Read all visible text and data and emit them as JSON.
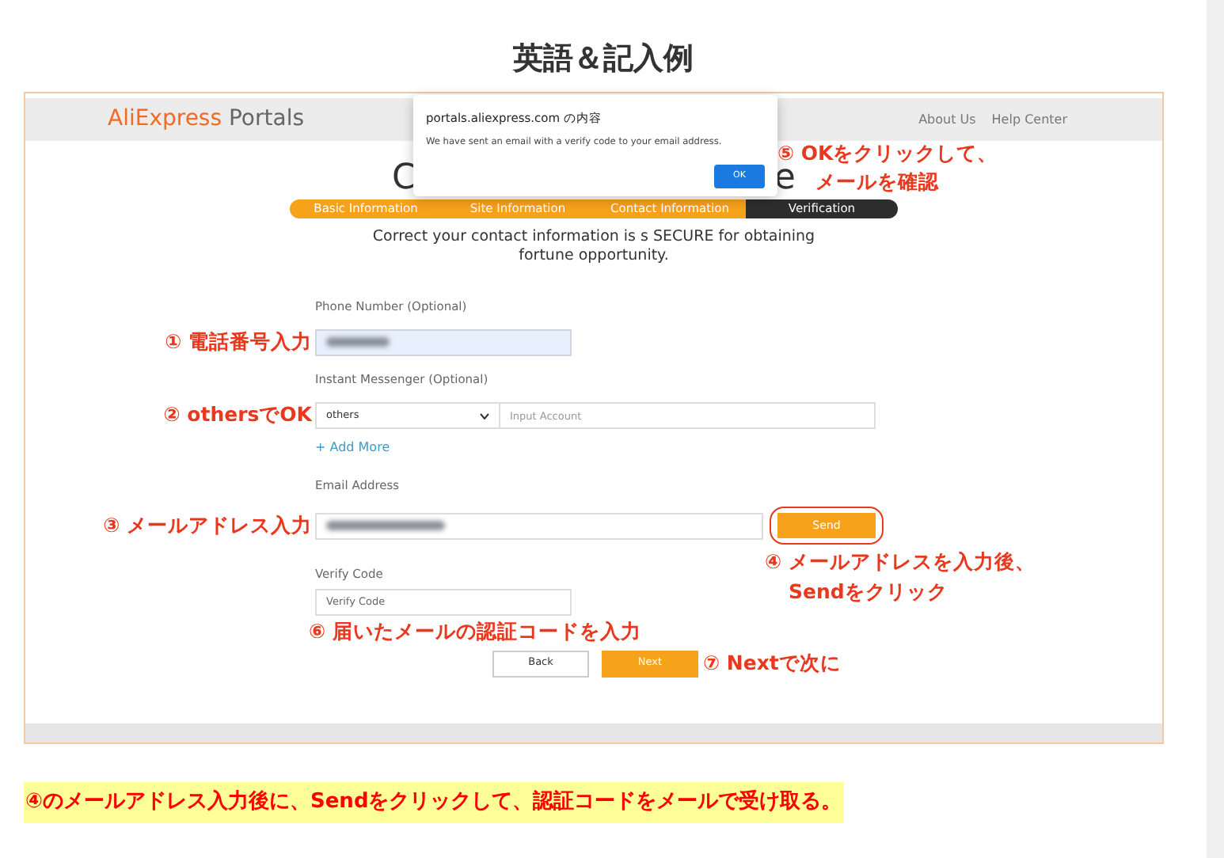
{
  "heading": "英語＆記入例",
  "screenshot": {
    "header": {
      "logo_primary": "AliExpress",
      "logo_secondary": "Portals",
      "links": [
        "About Us",
        "Help Center"
      ]
    },
    "title_fragments": [
      "C",
      "e"
    ],
    "steps": [
      {
        "label": "Basic Information",
        "done": true
      },
      {
        "label": "Site Information",
        "done": true
      },
      {
        "label": "Contact Information",
        "done": true
      },
      {
        "label": "Verification",
        "done": false
      }
    ],
    "intro_lines": [
      "Correct your contact information is s SECURE for obtaining",
      "fortune opportunity."
    ],
    "form": {
      "phone_label": "Phone Number (Optional)",
      "messenger_label": "Instant Messenger (Optional)",
      "messenger_select": "others",
      "account_placeholder": "Input Account",
      "add_more": "+ Add More",
      "email_label": "Email Address",
      "send": "Send",
      "verify_label": "Verify Code",
      "verify_placeholder": "Verify Code",
      "back": "Back",
      "next": "Next"
    },
    "dialog": {
      "title": "portals.aliexpress.com の内容",
      "message": "We have sent an email with a verify code to your email address.",
      "ok": "OK"
    },
    "annotations": {
      "phone": "① 電話番号入力",
      "messenger": "② othersでOK",
      "email": "③ メールアドレス入力",
      "send": [
        "④ メールアドレスを入力後、",
        "Sendをクリック"
      ],
      "ok": [
        "⑤ OKをクリックして、",
        "メールを確認"
      ],
      "verify": "⑥ 届いたメールの認証コードを入力",
      "next": "⑦ Nextで次に"
    }
  },
  "caption": "④のメールアドレス入力後に、Sendをクリックして、認証コードをメールで受け取る。"
}
